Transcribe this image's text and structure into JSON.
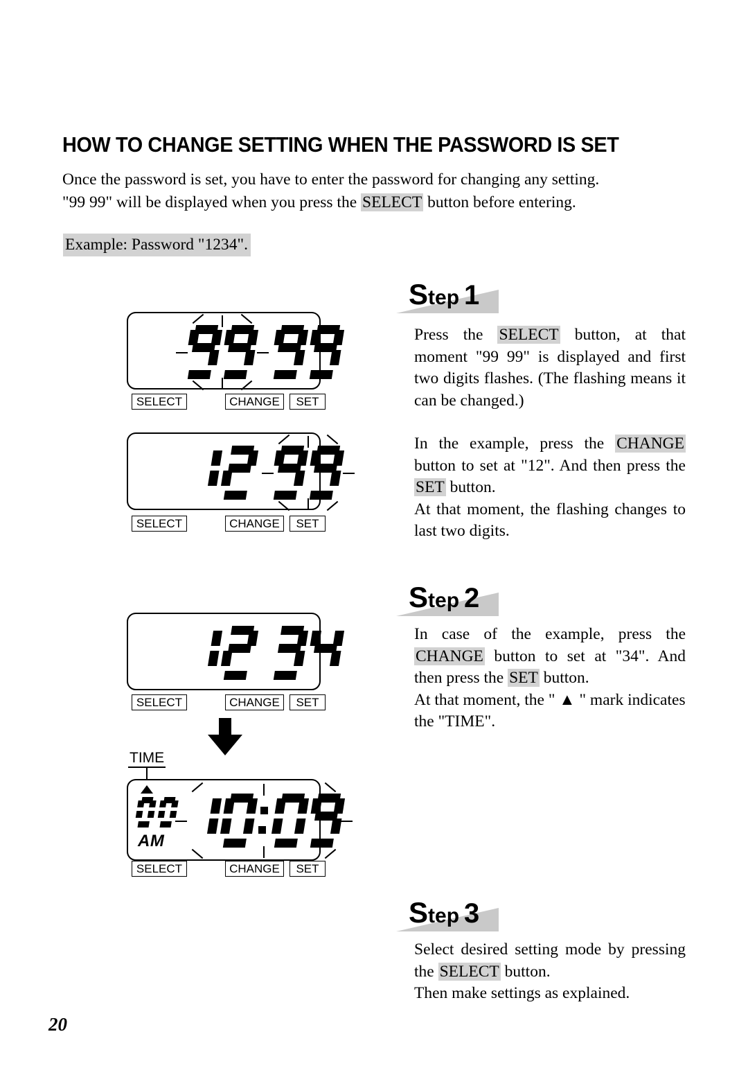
{
  "page": {
    "title": "HOW TO CHANGE SETTING WHEN THE PASSWORD IS SET",
    "number": "20"
  },
  "intro": {
    "line1": "Once the password is set, you have to enter the password for changing any setting.",
    "line2_before": "\"99 99\" will be displayed when you press the ",
    "line2_button": "SELECT",
    "line2_after": " button before entering.",
    "example": "Example: Password \"1234\"."
  },
  "steps": [
    {
      "word": "S",
      "word_rest": "tep",
      "number": "1",
      "paragraphs": [
        {
          "justify": true,
          "parts": [
            {
              "text": "Press the ",
              "highlight": false
            },
            {
              "text": "SELECT",
              "highlight": true
            },
            {
              "text": " button, at that moment \"99 99\" is displayed and first two digits flashes. (The flashing means it can be changed.)",
              "highlight": false
            }
          ]
        },
        {
          "justify": true,
          "spacer": true,
          "parts": [
            {
              "text": "In the example, press the ",
              "highlight": false
            },
            {
              "text": "CHANGE",
              "highlight": true
            },
            {
              "text": " button to set at \"12\". And then press the ",
              "highlight": false
            },
            {
              "text": "SET",
              "highlight": true
            },
            {
              "text": " button.",
              "highlight": false
            }
          ]
        },
        {
          "justify": true,
          "parts": [
            {
              "text": "At that moment, the flashing changes to last two digits.",
              "highlight": false
            }
          ]
        }
      ]
    },
    {
      "word": "S",
      "word_rest": "tep",
      "number": "2",
      "paragraphs": [
        {
          "justify": true,
          "parts": [
            {
              "text": "In case of the example, press the ",
              "highlight": false
            },
            {
              "text": "CHANGE",
              "highlight": true
            },
            {
              "text": " button to set at \"34\". And then press the ",
              "highlight": false
            },
            {
              "text": "SET",
              "highlight": true
            },
            {
              "text": " button.",
              "highlight": false
            }
          ]
        },
        {
          "justify": false,
          "parts": [
            {
              "text": "At that moment, the \" ▲ \" mark indicates the \"TIME\".",
              "highlight": false
            }
          ]
        }
      ]
    },
    {
      "word": "S",
      "word_rest": "tep",
      "number": "3",
      "paragraphs": [
        {
          "justify": true,
          "parts": [
            {
              "text": "Select desired setting mode by pressing the ",
              "highlight": false
            },
            {
              "text": "SELECT",
              "highlight": true
            },
            {
              "text": " button.",
              "highlight": false
            }
          ]
        },
        {
          "justify": false,
          "parts": [
            {
              "text": "Then make settings as explained.",
              "highlight": false
            }
          ]
        }
      ]
    }
  ],
  "buttons": {
    "select": "SELECT",
    "change": "CHANGE",
    "set": "SET"
  },
  "panels": [
    {
      "name": "panel-99-99",
      "display": "99 99",
      "digits": [
        "9",
        "9",
        "9",
        "9"
      ],
      "flashing": "first-two",
      "mode_label": null,
      "ampm": null,
      "small_digits": null,
      "triangle_marker": false,
      "colon": false
    },
    {
      "name": "panel-12-99",
      "display": "12 99",
      "digits": [
        "1",
        "2",
        "9",
        "9"
      ],
      "flashing": "last-two",
      "mode_label": null,
      "ampm": null,
      "small_digits": null,
      "triangle_marker": false,
      "colon": false
    },
    {
      "name": "panel-12-34",
      "display": "12 34",
      "digits": [
        "1",
        "2",
        "3",
        "4"
      ],
      "flashing": "none",
      "mode_label": null,
      "ampm": null,
      "small_digits": null,
      "triangle_marker": false,
      "colon": false
    },
    {
      "name": "panel-time-1009",
      "display": "10:09",
      "digits": [
        "1",
        "0",
        "0",
        "9"
      ],
      "flashing": "all",
      "mode_label": "TIME",
      "ampm": "AM",
      "small_digits": [
        "0",
        "0"
      ],
      "triangle_marker": true,
      "colon": true
    }
  ],
  "colors": {
    "highlight": "#d2d2d2",
    "wedge": "#c9c9c9",
    "ink": "#000000",
    "paper": "#ffffff"
  }
}
